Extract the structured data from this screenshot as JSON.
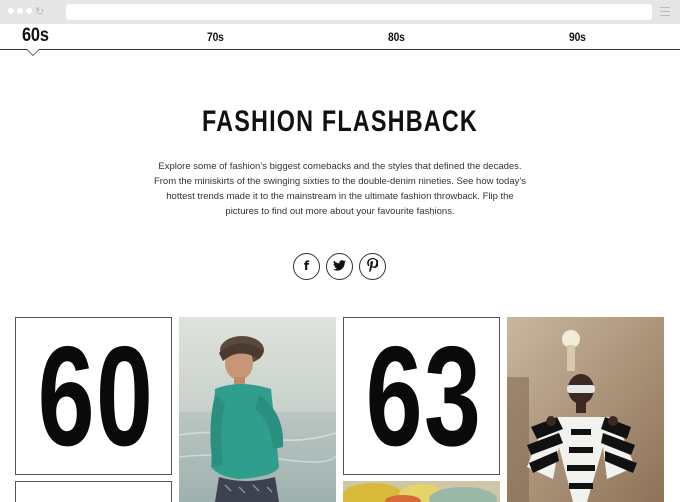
{
  "decades": [
    {
      "label": "60s",
      "active": true
    },
    {
      "label": "70s",
      "active": false
    },
    {
      "label": "80s",
      "active": false
    },
    {
      "label": "90s",
      "active": false
    }
  ],
  "hero": {
    "title": "FASHION FLASHBACK",
    "intro": "Explore some of fashion’s biggest comebacks and the styles that defined the decades. From the miniskirts of the swinging sixties to the double-denim nineties. See how today’s hottest trends made it to the mainstream in the ultimate fashion throwback. Flip the pictures to find out more about your favourite fashions."
  },
  "social": [
    {
      "glyph": "f",
      "icon": "facebook-icon"
    },
    {
      "glyph": "𝕥",
      "icon": "twitter-icon"
    },
    {
      "glyph": "℗",
      "icon": "pinterest-icon"
    }
  ],
  "grid": {
    "cards": [
      {
        "year": "60"
      },
      {
        "year": "63"
      }
    ],
    "photos": [
      {
        "subject": "woman in teal sweater by the sea"
      },
      {
        "subject": "model in striped black and white outfit"
      },
      {
        "subject": "colorful knit items"
      }
    ]
  },
  "colors": {
    "chrome": "#e6e6e6",
    "sea": "#c9d3cf",
    "sweater": "#2f9e8c",
    "studio": "#a68a6c"
  }
}
